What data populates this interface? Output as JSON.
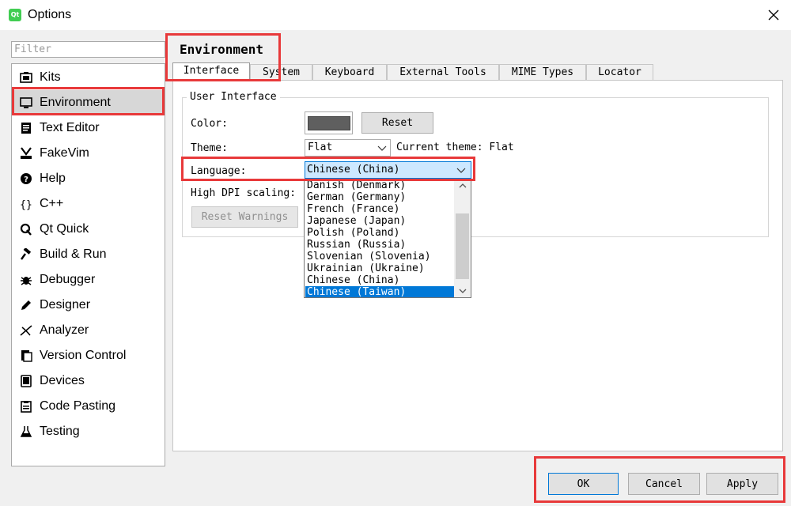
{
  "window": {
    "title": "Options",
    "app_icon_text": "Qt"
  },
  "filter": {
    "placeholder": "Filter"
  },
  "sidebar": {
    "items": [
      {
        "label": "Kits",
        "icon": "kits-icon"
      },
      {
        "label": "Environment",
        "icon": "monitor-icon",
        "selected": true
      },
      {
        "label": "Text Editor",
        "icon": "text-editor-icon"
      },
      {
        "label": "FakeVim",
        "icon": "fakevim-icon"
      },
      {
        "label": "Help",
        "icon": "help-icon"
      },
      {
        "label": "C++",
        "icon": "braces-icon"
      },
      {
        "label": "Qt Quick",
        "icon": "qt-quick-icon"
      },
      {
        "label": "Build & Run",
        "icon": "hammer-icon"
      },
      {
        "label": "Debugger",
        "icon": "bug-icon"
      },
      {
        "label": "Designer",
        "icon": "pencil-icon"
      },
      {
        "label": "Analyzer",
        "icon": "analyzer-icon"
      },
      {
        "label": "Version Control",
        "icon": "version-control-icon"
      },
      {
        "label": "Devices",
        "icon": "devices-icon"
      },
      {
        "label": "Code Pasting",
        "icon": "clipboard-icon"
      },
      {
        "label": "Testing",
        "icon": "flask-icon"
      }
    ]
  },
  "page": {
    "title": "Environment",
    "tabs": [
      {
        "label": "Interface",
        "active": true
      },
      {
        "label": "System"
      },
      {
        "label": "Keyboard"
      },
      {
        "label": "External Tools"
      },
      {
        "label": "MIME Types"
      },
      {
        "label": "Locator"
      }
    ]
  },
  "interface": {
    "group_title": "User Interface",
    "color_label": "Color:",
    "color_value": "#5f5f5f",
    "reset_label": "Reset",
    "theme_label": "Theme:",
    "theme_value": "Flat",
    "current_theme": "Current theme: Flat",
    "language_label": "Language:",
    "language_value": "Chinese (China)",
    "high_dpi_label": "High DPI scaling:",
    "reset_warnings_label": "Reset Warnings"
  },
  "language_dropdown": {
    "options": [
      "Danish (Denmark)",
      "German (Germany)",
      "French (France)",
      "Japanese (Japan)",
      "Polish (Poland)",
      "Russian (Russia)",
      "Slovenian (Slovenia)",
      "Ukrainian (Ukraine)",
      "Chinese (China)",
      "Chinese (Taiwan)"
    ],
    "highlighted": "Chinese (Taiwan)"
  },
  "footer": {
    "ok": "OK",
    "cancel": "Cancel",
    "apply": "Apply"
  },
  "colors": {
    "highlight_box": "#e8393a",
    "selection": "#0078d7",
    "sidebar_selected": "#d7d7d7"
  }
}
